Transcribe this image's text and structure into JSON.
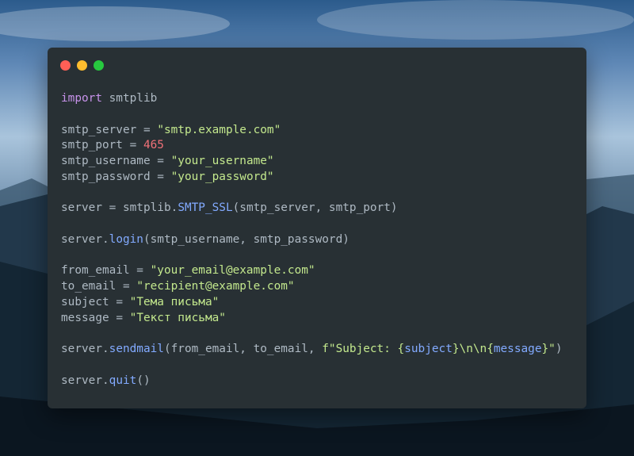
{
  "colors": {
    "close_dot": "#ff5f56",
    "minimize_dot": "#ffbd2e",
    "maximize_dot": "#27c93f",
    "window_bg": "#283034",
    "keyword": "#c792ea",
    "string": "#c3e88d",
    "number": "#f07178",
    "function": "#82aaff",
    "plain": "#aeb9c3"
  },
  "code": {
    "lines": [
      [
        {
          "t": "import",
          "c": "kw"
        },
        {
          "t": " smtplib",
          "c": "plain"
        }
      ],
      [],
      [
        {
          "t": "smtp_server",
          "c": "plain"
        },
        {
          "t": " = ",
          "c": "plain"
        },
        {
          "t": "\"smtp.example.com\"",
          "c": "str"
        }
      ],
      [
        {
          "t": "smtp_port",
          "c": "plain"
        },
        {
          "t": " = ",
          "c": "plain"
        },
        {
          "t": "465",
          "c": "num"
        }
      ],
      [
        {
          "t": "smtp_username",
          "c": "plain"
        },
        {
          "t": " = ",
          "c": "plain"
        },
        {
          "t": "\"your_username\"",
          "c": "str"
        }
      ],
      [
        {
          "t": "smtp_password",
          "c": "plain"
        },
        {
          "t": " = ",
          "c": "plain"
        },
        {
          "t": "\"your_password\"",
          "c": "str"
        }
      ],
      [],
      [
        {
          "t": "server",
          "c": "plain"
        },
        {
          "t": " = ",
          "c": "plain"
        },
        {
          "t": "smtplib",
          "c": "plain"
        },
        {
          "t": ".",
          "c": "plain"
        },
        {
          "t": "SMTP_SSL",
          "c": "fn"
        },
        {
          "t": "(smtp_server, smtp_port)",
          "c": "plain"
        }
      ],
      [],
      [
        {
          "t": "server",
          "c": "plain"
        },
        {
          "t": ".",
          "c": "plain"
        },
        {
          "t": "login",
          "c": "fn"
        },
        {
          "t": "(smtp_username, smtp_password)",
          "c": "plain"
        }
      ],
      [],
      [
        {
          "t": "from_email",
          "c": "plain"
        },
        {
          "t": " = ",
          "c": "plain"
        },
        {
          "t": "\"your_email@example.com\"",
          "c": "str"
        }
      ],
      [
        {
          "t": "to_email",
          "c": "plain"
        },
        {
          "t": " = ",
          "c": "plain"
        },
        {
          "t": "\"recipient@example.com\"",
          "c": "str"
        }
      ],
      [
        {
          "t": "subject",
          "c": "plain"
        },
        {
          "t": " = ",
          "c": "plain"
        },
        {
          "t": "\"Тема письма\"",
          "c": "str"
        }
      ],
      [
        {
          "t": "message",
          "c": "plain"
        },
        {
          "t": " = ",
          "c": "plain"
        },
        {
          "t": "\"Текст письма\"",
          "c": "str"
        }
      ],
      [],
      [
        {
          "t": "server",
          "c": "plain"
        },
        {
          "t": ".",
          "c": "plain"
        },
        {
          "t": "sendmail",
          "c": "fn"
        },
        {
          "t": "(from_email, to_email, ",
          "c": "plain"
        },
        {
          "t": "f\"Subject: {",
          "c": "str"
        },
        {
          "t": "subject",
          "c": "fn"
        },
        {
          "t": "}\\n\\n{",
          "c": "str"
        },
        {
          "t": "message",
          "c": "fn"
        },
        {
          "t": "}\"",
          "c": "str"
        },
        {
          "t": ")",
          "c": "plain"
        }
      ],
      [],
      [
        {
          "t": "server",
          "c": "plain"
        },
        {
          "t": ".",
          "c": "plain"
        },
        {
          "t": "quit",
          "c": "fn"
        },
        {
          "t": "()",
          "c": "plain"
        }
      ]
    ]
  }
}
